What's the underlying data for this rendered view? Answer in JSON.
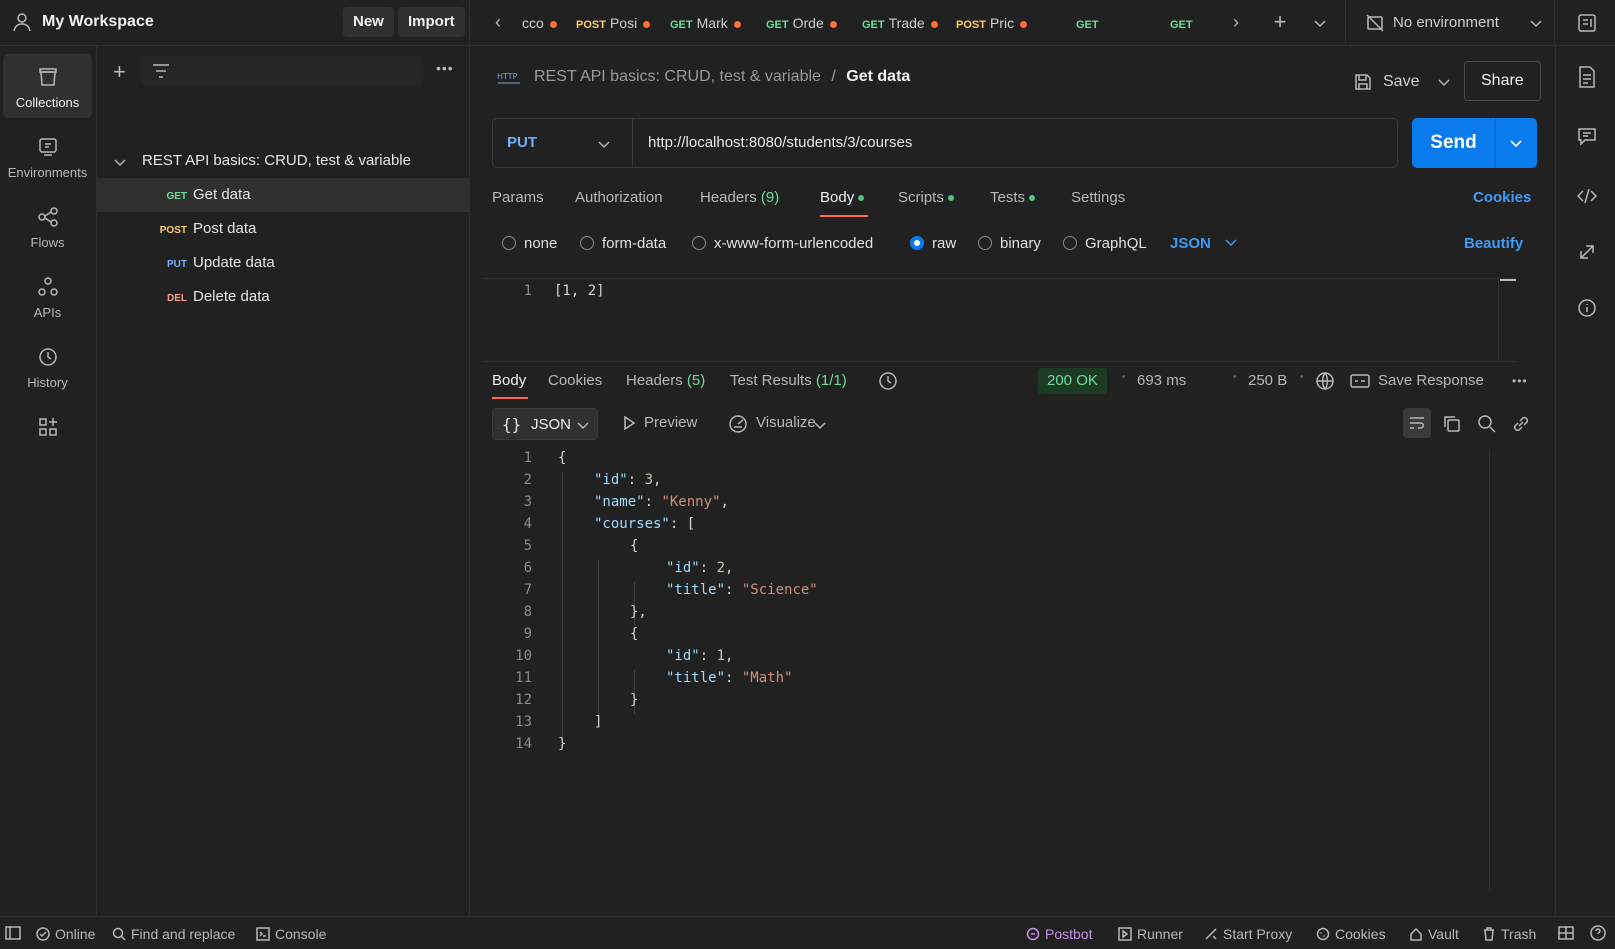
{
  "workspace": {
    "name": "My Workspace",
    "new_label": "New",
    "import_label": "Import"
  },
  "tabs": [
    {
      "method": "",
      "label": "cco"
    },
    {
      "method": "POST",
      "label": "Posi"
    },
    {
      "method": "GET",
      "label": "Mark"
    },
    {
      "method": "GET",
      "label": "Orde"
    },
    {
      "method": "GET",
      "label": "Trade"
    },
    {
      "method": "POST",
      "label": "Pric"
    },
    {
      "method": "GET",
      "label": ""
    },
    {
      "method": "GET",
      "label": ""
    }
  ],
  "environment": {
    "label": "No environment"
  },
  "rail": {
    "collections": "Collections",
    "environments": "Environments",
    "flows": "Flows",
    "apis": "APIs",
    "history": "History"
  },
  "sidebar": {
    "collection_name": "REST API basics: CRUD, test & variable",
    "items": [
      {
        "method": "GET",
        "label": "Get data"
      },
      {
        "method": "POST",
        "label": "Post data"
      },
      {
        "method": "PUT",
        "label": "Update data"
      },
      {
        "method": "DEL",
        "label": "Delete data"
      }
    ]
  },
  "request": {
    "breadcrumb_parent": "REST API basics: CRUD, test & variable",
    "breadcrumb_sep": "/",
    "breadcrumb_current": "Get data",
    "save_label": "Save",
    "share_label": "Share",
    "method": "PUT",
    "url": "http://localhost:8080/students/3/courses",
    "send_label": "Send",
    "tabs": {
      "params": "Params",
      "authorization": "Authorization",
      "headers": "Headers",
      "headers_count": "(9)",
      "body": "Body",
      "scripts": "Scripts",
      "tests": "Tests",
      "settings": "Settings",
      "cookies": "Cookies"
    },
    "body_types": {
      "none": "none",
      "form_data": "form-data",
      "urlencoded": "x-www-form-urlencoded",
      "raw": "raw",
      "binary": "binary",
      "graphql": "GraphQL",
      "format": "JSON",
      "beautify": "Beautify"
    },
    "body_lines": [
      {
        "num": "1",
        "text": "[1, 2]"
      }
    ]
  },
  "response": {
    "tabs": {
      "body": "Body",
      "cookies": "Cookies",
      "headers": "Headers",
      "headers_count": "(5)",
      "tests": "Test Results",
      "tests_count": "(1/1)"
    },
    "status": "200 OK",
    "time": "693 ms",
    "size": "250 B",
    "save_response": "Save Response",
    "format": "JSON",
    "preview": "Preview",
    "visualize": "Visualize",
    "line_numbers": [
      "1",
      "2",
      "3",
      "4",
      "5",
      "6",
      "7",
      "8",
      "9",
      "10",
      "11",
      "12",
      "13",
      "14"
    ],
    "lines": {
      "l1": "{",
      "id_key": "\"id\"",
      "id_val": "3",
      "name_key": "\"name\"",
      "name_val": "\"Kenny\"",
      "courses_key": "\"courses\"",
      "c1_id_key": "\"id\"",
      "c1_id_val": "2",
      "c1_title_key": "\"title\"",
      "c1_title_val": "\"Science\"",
      "c2_id_key": "\"id\"",
      "c2_id_val": "1",
      "c2_title_key": "\"title\"",
      "c2_title_val": "\"Math\""
    }
  },
  "footer": {
    "online": "Online",
    "find_replace": "Find and replace",
    "console": "Console",
    "postbot": "Postbot",
    "runner": "Runner",
    "start_proxy": "Start Proxy",
    "cookies": "Cookies",
    "vault": "Vault",
    "trash": "Trash"
  },
  "colors": {
    "accent": "#097bed",
    "postman_orange": "#ff6c37",
    "status_ok": "#6bdd9a",
    "postbot": "#c792ea"
  }
}
